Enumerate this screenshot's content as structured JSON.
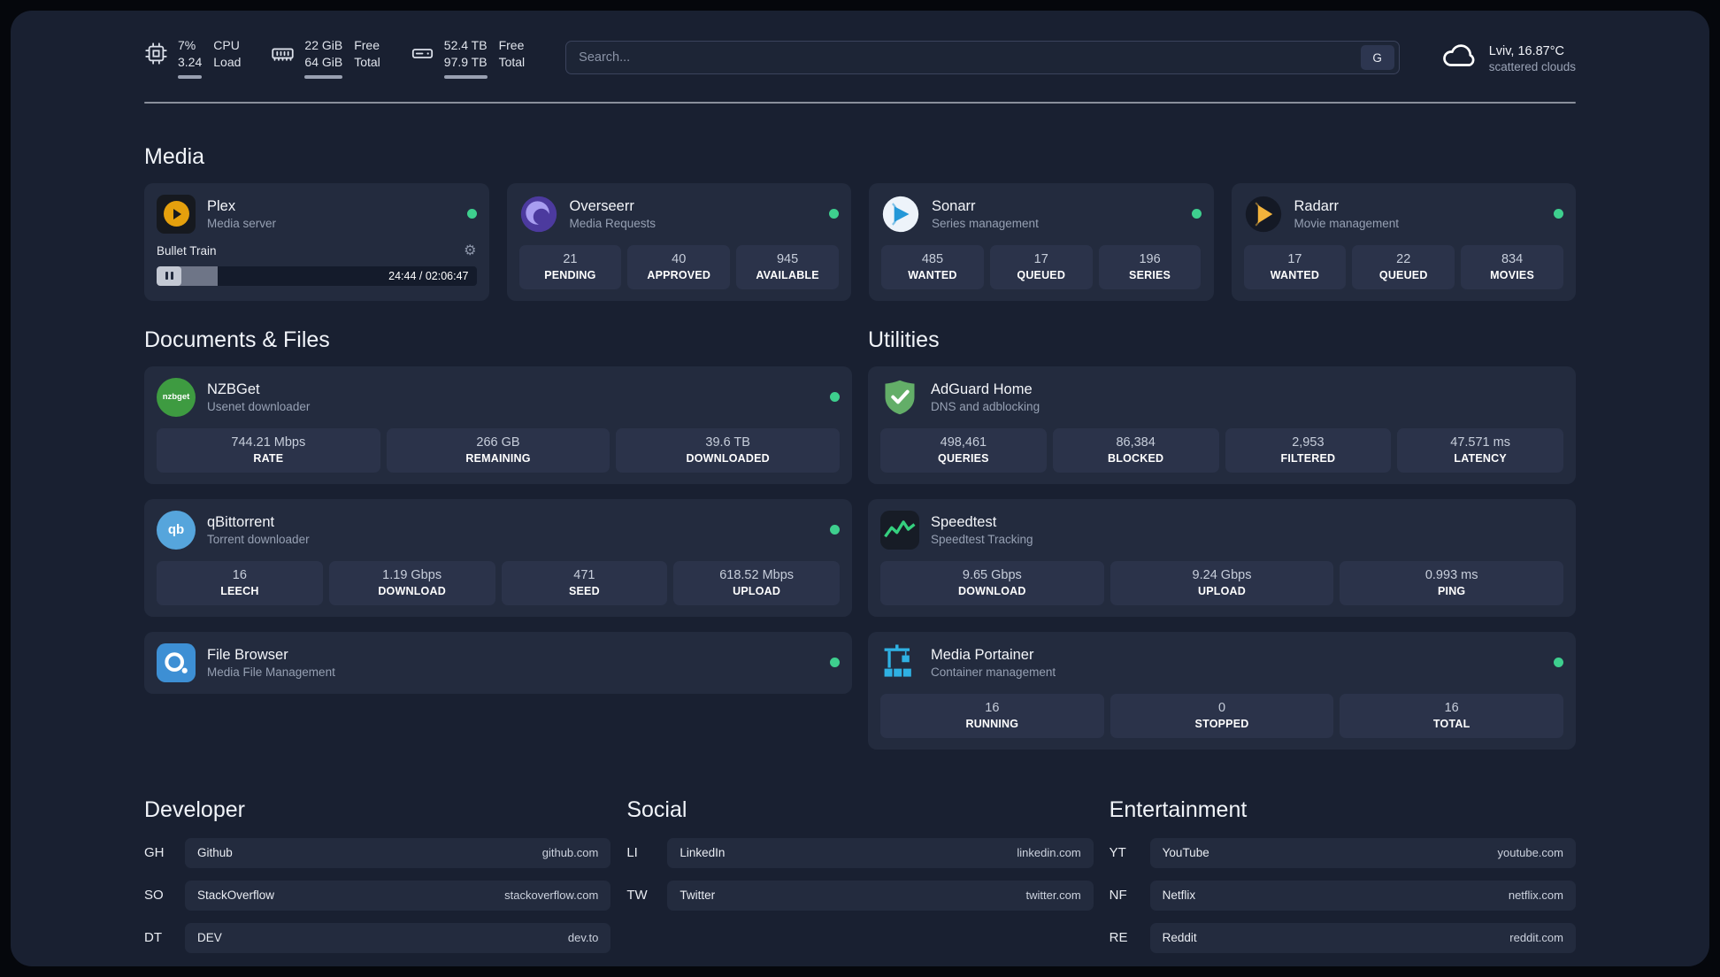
{
  "topbar": {
    "cpu": {
      "values": [
        "7%",
        "3.24"
      ],
      "labels": [
        "CPU",
        "Load"
      ]
    },
    "ram": {
      "values": [
        "22 GiB",
        "64 GiB"
      ],
      "labels": [
        "Free",
        "Total"
      ]
    },
    "disk": {
      "values": [
        "52.4 TB",
        "97.9 TB"
      ],
      "labels": [
        "Free",
        "Total"
      ]
    },
    "search": {
      "placeholder": "Search...",
      "button_label": "G"
    },
    "weather": {
      "location": "Lviv, 16.87°C",
      "condition": "scattered clouds"
    }
  },
  "icons": {
    "gear": "⚙"
  },
  "sections": {
    "media": {
      "title": "Media",
      "apps": [
        {
          "name": "Plex",
          "desc": "Media server",
          "player": {
            "track": "Bullet Train",
            "time": "24:44 / 02:06:47",
            "progress_pct": 19
          }
        },
        {
          "name": "Overseerr",
          "desc": "Media Requests",
          "stats": [
            {
              "value": "21",
              "label": "PENDING"
            },
            {
              "value": "40",
              "label": "APPROVED"
            },
            {
              "value": "945",
              "label": "AVAILABLE"
            }
          ]
        },
        {
          "name": "Sonarr",
          "desc": "Series management",
          "stats": [
            {
              "value": "485",
              "label": "WANTED"
            },
            {
              "value": "17",
              "label": "QUEUED"
            },
            {
              "value": "196",
              "label": "SERIES"
            }
          ]
        },
        {
          "name": "Radarr",
          "desc": "Movie management",
          "stats": [
            {
              "value": "17",
              "label": "WANTED"
            },
            {
              "value": "22",
              "label": "QUEUED"
            },
            {
              "value": "834",
              "label": "MOVIES"
            }
          ]
        }
      ]
    },
    "documents": {
      "title": "Documents & Files",
      "apps": [
        {
          "name": "NZBGet",
          "desc": "Usenet downloader",
          "icon_text": "nzbget",
          "stats": [
            {
              "value": "744.21 Mbps",
              "label": "RATE"
            },
            {
              "value": "266 GB",
              "label": "REMAINING"
            },
            {
              "value": "39.6 TB",
              "label": "DOWNLOADED"
            }
          ]
        },
        {
          "name": "qBittorrent",
          "desc": "Torrent downloader",
          "icon_text": "qb",
          "stats": [
            {
              "value": "16",
              "label": "LEECH"
            },
            {
              "value": "1.19 Gbps",
              "label": "DOWNLOAD"
            },
            {
              "value": "471",
              "label": "SEED"
            },
            {
              "value": "618.52 Mbps",
              "label": "UPLOAD"
            }
          ]
        },
        {
          "name": "File Browser",
          "desc": "Media File Management"
        }
      ]
    },
    "utilities": {
      "title": "Utilities",
      "apps": [
        {
          "name": "AdGuard Home",
          "desc": "DNS and adblocking",
          "stats": [
            {
              "value": "498,461",
              "label": "QUERIES"
            },
            {
              "value": "86,384",
              "label": "BLOCKED"
            },
            {
              "value": "2,953",
              "label": "FILTERED"
            },
            {
              "value": "47.571 ms",
              "label": "LATENCY"
            }
          ]
        },
        {
          "name": "Speedtest",
          "desc": "Speedtest Tracking",
          "stats": [
            {
              "value": "9.65 Gbps",
              "label": "DOWNLOAD"
            },
            {
              "value": "9.24 Gbps",
              "label": "UPLOAD"
            },
            {
              "value": "0.993 ms",
              "label": "PING"
            }
          ]
        },
        {
          "name": "Media Portainer",
          "desc": "Container management",
          "stats": [
            {
              "value": "16",
              "label": "RUNNING"
            },
            {
              "value": "0",
              "label": "STOPPED"
            },
            {
              "value": "16",
              "label": "TOTAL"
            }
          ]
        }
      ]
    }
  },
  "links": {
    "developer": {
      "title": "Developer",
      "items": [
        {
          "abbr": "GH",
          "name": "Github",
          "domain": "github.com"
        },
        {
          "abbr": "SO",
          "name": "StackOverflow",
          "domain": "stackoverflow.com"
        },
        {
          "abbr": "DT",
          "name": "DEV",
          "domain": "dev.to"
        }
      ]
    },
    "social": {
      "title": "Social",
      "items": [
        {
          "abbr": "LI",
          "name": "LinkedIn",
          "domain": "linkedin.com"
        },
        {
          "abbr": "TW",
          "name": "Twitter",
          "domain": "twitter.com"
        }
      ]
    },
    "entertainment": {
      "title": "Entertainment",
      "items": [
        {
          "abbr": "YT",
          "name": "YouTube",
          "domain": "youtube.com"
        },
        {
          "abbr": "NF",
          "name": "Netflix",
          "domain": "netflix.com"
        },
        {
          "abbr": "RE",
          "name": "Reddit",
          "domain": "reddit.com"
        }
      ]
    }
  },
  "colors": {
    "status_online": "#3ecf8e",
    "page_bg": "#192031",
    "card_bg": "#232b3e",
    "tile_bg": "#2b334a",
    "plex_amber": "#e5a00d"
  }
}
